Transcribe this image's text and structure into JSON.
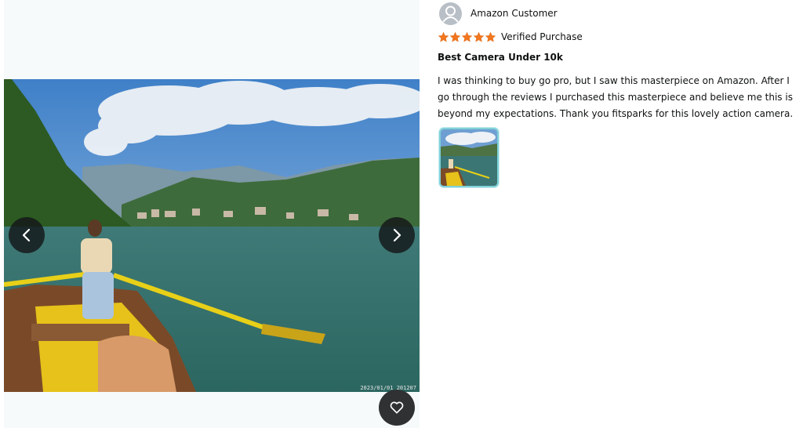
{
  "review": {
    "author": "Amazon Customer",
    "rating": 5,
    "rating_max": 5,
    "verified_label": "Verified Purchase",
    "title": "Best Camera Under 10k",
    "body": "I was thinking to buy go pro, but I saw this masterpiece on Amazon. After I go through the reviews I purchased this masterpiece and believe me this is beyond my expectations. Thank you fitsparks for this lovely action camera."
  },
  "media": {
    "timestamp": "2023/01/01 201207"
  },
  "icons": {
    "prev": "chevron-left-icon",
    "next": "chevron-right-icon",
    "favorite": "heart-outline-icon",
    "avatar": "user-silhouette-icon",
    "star": "star-filled-icon"
  },
  "colors": {
    "star": "#f1761f",
    "nav_button": "#141618",
    "thumb_border": "#7fd0d8"
  }
}
